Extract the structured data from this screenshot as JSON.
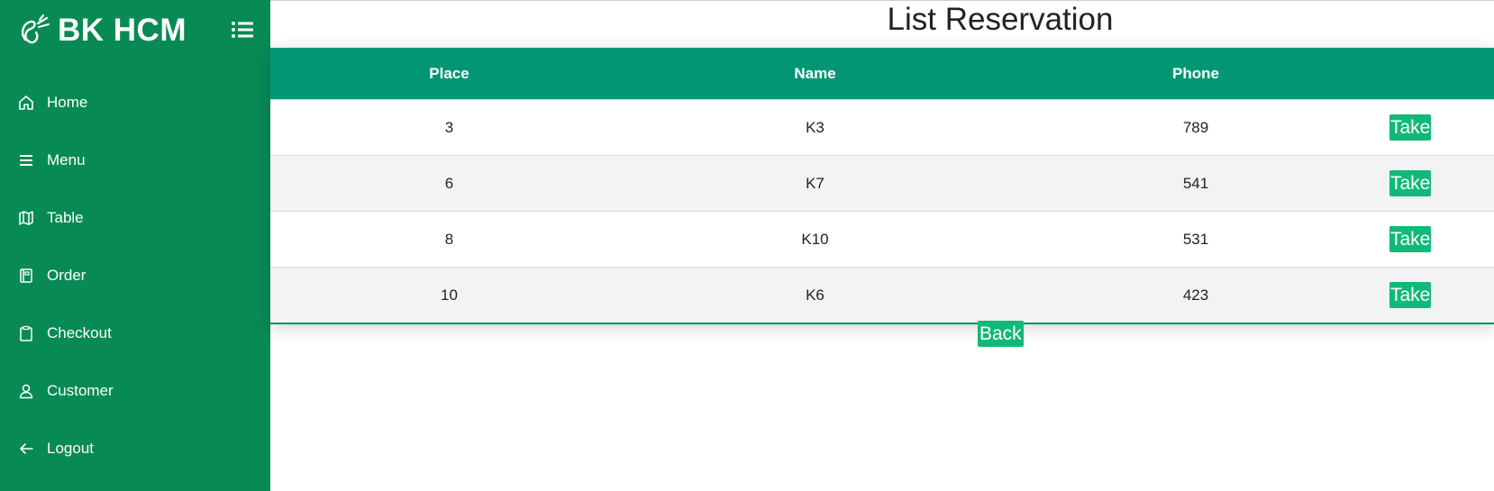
{
  "brand": {
    "name": "BK HCM",
    "logo_icon": "utensils-logo-icon",
    "menu_icon": "list-menu-icon"
  },
  "sidebar": {
    "items": [
      {
        "label": "Home",
        "icon": "home-icon"
      },
      {
        "label": "Menu",
        "icon": "menu-lines-icon"
      },
      {
        "label": "Table",
        "icon": "map-icon"
      },
      {
        "label": "Order",
        "icon": "book-icon"
      },
      {
        "label": "Checkout",
        "icon": "clipboard-icon"
      },
      {
        "label": "Customer",
        "icon": "user-icon"
      },
      {
        "label": "Logout",
        "icon": "arrow-left-icon"
      }
    ]
  },
  "main": {
    "title": "List Reservation",
    "table": {
      "headers": [
        "Place",
        "Name",
        "Phone",
        ""
      ],
      "rows": [
        {
          "place": "3",
          "name": "K3",
          "phone": "789",
          "action": "Take"
        },
        {
          "place": "6",
          "name": "K7",
          "phone": "541",
          "action": "Take"
        },
        {
          "place": "8",
          "name": "K10",
          "phone": "531",
          "action": "Take"
        },
        {
          "place": "10",
          "name": "K6",
          "phone": "423",
          "action": "Take"
        }
      ]
    },
    "back_label": "Back"
  },
  "colors": {
    "sidebar": "#088a55",
    "table_header": "#029675",
    "button": "#12b879"
  }
}
